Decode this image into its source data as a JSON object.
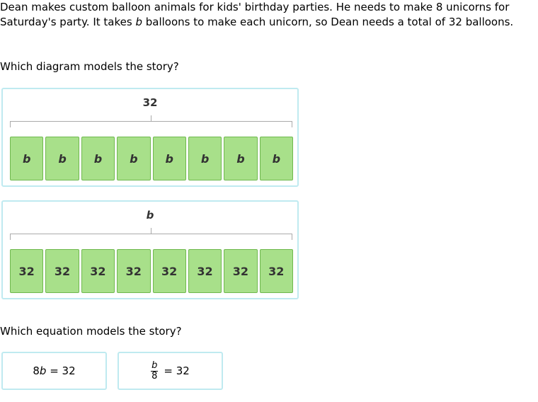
{
  "story": {
    "part1": "Dean makes custom balloon animals for kids' birthday parties. He needs to make 8 unicorns for Saturday's party. It takes ",
    "var": "b",
    "part2": " balloons to make each unicorn, so Dean needs a total of 32 balloons."
  },
  "question_diagram": "Which diagram models the story?",
  "diagram_a": {
    "total": "32",
    "boxes": [
      "b",
      "b",
      "b",
      "b",
      "b",
      "b",
      "b",
      "b"
    ]
  },
  "diagram_b": {
    "total": "b",
    "boxes": [
      "32",
      "32",
      "32",
      "32",
      "32",
      "32",
      "32",
      "32"
    ]
  },
  "question_equation": "Which equation models the story?",
  "equation_a": {
    "coef": "8",
    "var": "b",
    "rest": " = 32"
  },
  "equation_b": {
    "num": "b",
    "den": "8",
    "rest": "= 32"
  },
  "colors": {
    "box_fill": "#a8e08a",
    "box_border": "#6fb84e",
    "card_border": "#bfeaf0"
  }
}
